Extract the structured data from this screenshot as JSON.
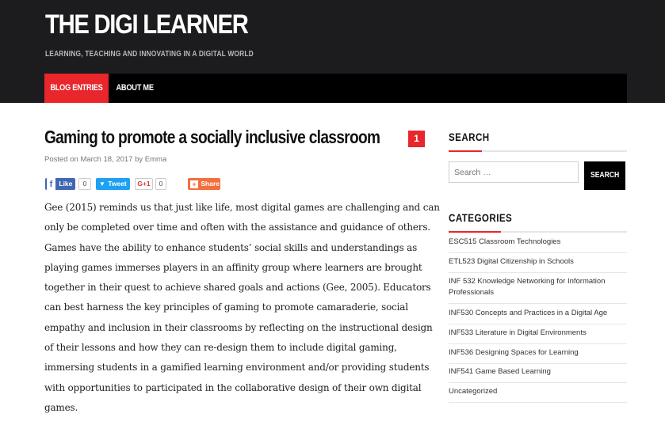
{
  "header": {
    "site_title": "THE DIGI LEARNER",
    "tagline": "LEARNING, TEACHING AND INNOVATING IN A DIGITAL WORLD"
  },
  "nav": {
    "items": [
      {
        "label": "BLOG ENTRIES",
        "active": true
      },
      {
        "label": "ABOUT ME",
        "active": false
      }
    ]
  },
  "post": {
    "title": "Gaming to promote a socially inclusive classroom",
    "comment_count": "1",
    "meta_prefix": "Posted on",
    "date": "March 18, 2017",
    "by": "by",
    "author": "Emma",
    "share": {
      "facebook_label": "Like",
      "facebook_count": "0",
      "twitter_label": "Tweet",
      "gplus_label": "G+1",
      "gplus_count": "0",
      "share_label": "Share"
    },
    "body_lines": [
      "Gee (2015) reminds us that just like life, most digital games are challenging and can",
      "only be completed over time and often with the assistance and guidance of others.",
      "Games have the ability to enhance students’ social skills and understandings as",
      "playing games immerses players in an affinity group where learners are brought",
      "together in their quest to achieve shared goals and actions (Gee, 2005). Educators",
      "can best harness the key principles of gaming to promote camaraderie, social",
      "empathy and inclusion in their classrooms by reflecting on the instructional design",
      "of their lessons and how they can re-design them to include digital gaming,",
      "immersing students in a gamified learning environment and/or providing students",
      "with opportunities to participated in the collaborative design of their own digital",
      "games."
    ]
  },
  "sidebar": {
    "search": {
      "title": "SEARCH",
      "placeholder": "Search …",
      "button_label": "SEARCH"
    },
    "categories": {
      "title": "CATEGORIES",
      "items": [
        "ESC515 Classroom Technologies",
        "ETL523 Digital Citizenship in Schools",
        "INF 532 Knowledge Networking for Information Professionals",
        "INF530 Concepts and Practices in a Digital Age",
        "INF533 Literature in Digital Environments",
        "INF536 Designing Spaces for Learning",
        "INF541 Game Based Learning",
        "Uncategorized"
      ]
    }
  },
  "colors": {
    "accent": "#e8262c",
    "header_bg": "#1c1c1e",
    "nav_bg": "#000000",
    "facebook": "#4267b2",
    "twitter": "#1da1f2",
    "gplus": "#ffffff",
    "share": "#f26f3d"
  },
  "icons": [
    "facebook-icon",
    "twitter-icon",
    "share-plus-icon"
  ]
}
